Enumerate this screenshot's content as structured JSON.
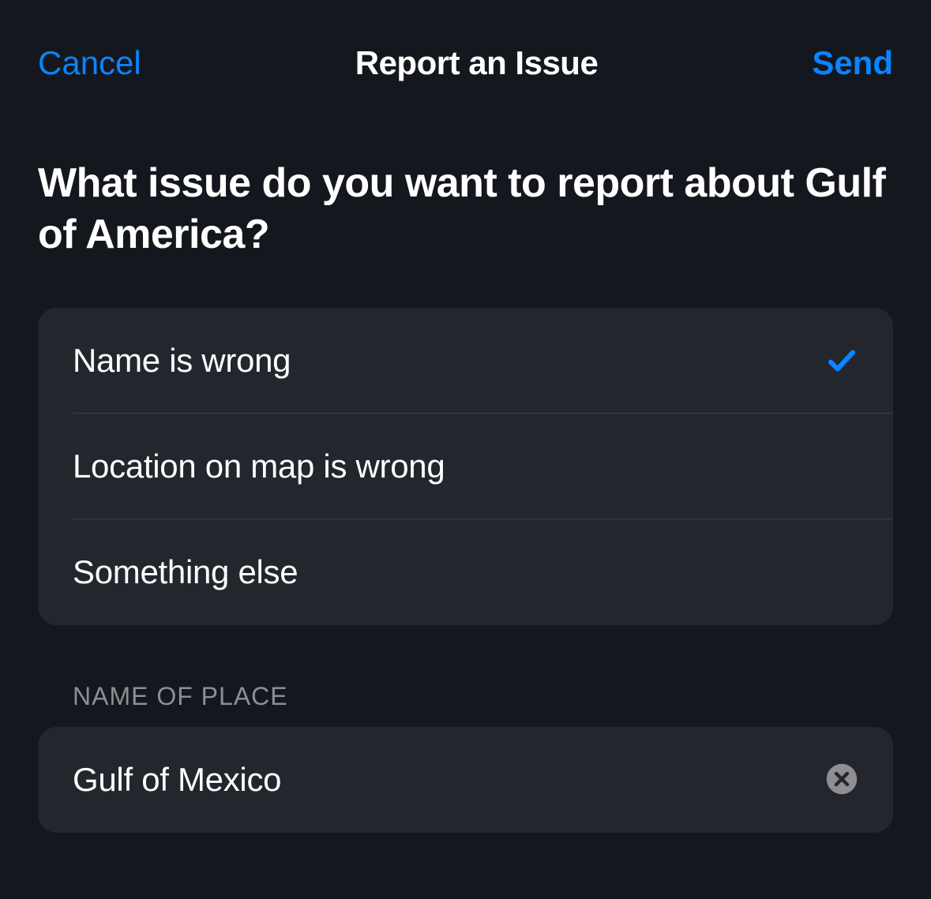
{
  "nav": {
    "cancel_label": "Cancel",
    "title": "Report an Issue",
    "send_label": "Send"
  },
  "question": "What issue do you want to report about Gulf of America?",
  "options": [
    {
      "label": "Name is wrong",
      "selected": true
    },
    {
      "label": "Location on map is wrong",
      "selected": false
    },
    {
      "label": "Something else",
      "selected": false
    }
  ],
  "name_section": {
    "header": "NAME OF PLACE",
    "value": "Gulf of Mexico"
  },
  "colors": {
    "accent": "#0a84ff",
    "background": "#14171e",
    "cell": "#23262d",
    "text_primary": "#ffffff",
    "text_secondary": "#8e8e93"
  }
}
